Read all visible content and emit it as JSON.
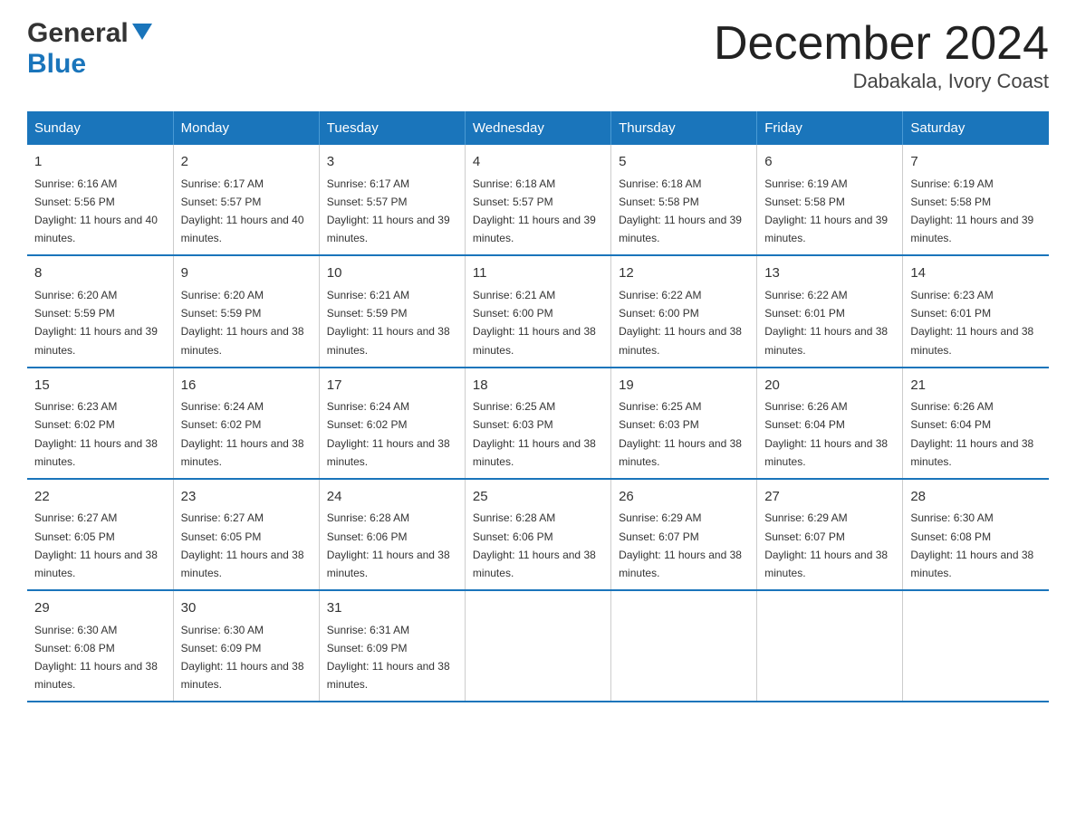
{
  "logo": {
    "text1": "General",
    "text2": "Blue"
  },
  "title": "December 2024",
  "subtitle": "Dabakala, Ivory Coast",
  "days_of_week": [
    "Sunday",
    "Monday",
    "Tuesday",
    "Wednesday",
    "Thursday",
    "Friday",
    "Saturday"
  ],
  "weeks": [
    [
      {
        "day": "1",
        "sunrise": "Sunrise: 6:16 AM",
        "sunset": "Sunset: 5:56 PM",
        "daylight": "Daylight: 11 hours and 40 minutes."
      },
      {
        "day": "2",
        "sunrise": "Sunrise: 6:17 AM",
        "sunset": "Sunset: 5:57 PM",
        "daylight": "Daylight: 11 hours and 40 minutes."
      },
      {
        "day": "3",
        "sunrise": "Sunrise: 6:17 AM",
        "sunset": "Sunset: 5:57 PM",
        "daylight": "Daylight: 11 hours and 39 minutes."
      },
      {
        "day": "4",
        "sunrise": "Sunrise: 6:18 AM",
        "sunset": "Sunset: 5:57 PM",
        "daylight": "Daylight: 11 hours and 39 minutes."
      },
      {
        "day": "5",
        "sunrise": "Sunrise: 6:18 AM",
        "sunset": "Sunset: 5:58 PM",
        "daylight": "Daylight: 11 hours and 39 minutes."
      },
      {
        "day": "6",
        "sunrise": "Sunrise: 6:19 AM",
        "sunset": "Sunset: 5:58 PM",
        "daylight": "Daylight: 11 hours and 39 minutes."
      },
      {
        "day": "7",
        "sunrise": "Sunrise: 6:19 AM",
        "sunset": "Sunset: 5:58 PM",
        "daylight": "Daylight: 11 hours and 39 minutes."
      }
    ],
    [
      {
        "day": "8",
        "sunrise": "Sunrise: 6:20 AM",
        "sunset": "Sunset: 5:59 PM",
        "daylight": "Daylight: 11 hours and 39 minutes."
      },
      {
        "day": "9",
        "sunrise": "Sunrise: 6:20 AM",
        "sunset": "Sunset: 5:59 PM",
        "daylight": "Daylight: 11 hours and 38 minutes."
      },
      {
        "day": "10",
        "sunrise": "Sunrise: 6:21 AM",
        "sunset": "Sunset: 5:59 PM",
        "daylight": "Daylight: 11 hours and 38 minutes."
      },
      {
        "day": "11",
        "sunrise": "Sunrise: 6:21 AM",
        "sunset": "Sunset: 6:00 PM",
        "daylight": "Daylight: 11 hours and 38 minutes."
      },
      {
        "day": "12",
        "sunrise": "Sunrise: 6:22 AM",
        "sunset": "Sunset: 6:00 PM",
        "daylight": "Daylight: 11 hours and 38 minutes."
      },
      {
        "day": "13",
        "sunrise": "Sunrise: 6:22 AM",
        "sunset": "Sunset: 6:01 PM",
        "daylight": "Daylight: 11 hours and 38 minutes."
      },
      {
        "day": "14",
        "sunrise": "Sunrise: 6:23 AM",
        "sunset": "Sunset: 6:01 PM",
        "daylight": "Daylight: 11 hours and 38 minutes."
      }
    ],
    [
      {
        "day": "15",
        "sunrise": "Sunrise: 6:23 AM",
        "sunset": "Sunset: 6:02 PM",
        "daylight": "Daylight: 11 hours and 38 minutes."
      },
      {
        "day": "16",
        "sunrise": "Sunrise: 6:24 AM",
        "sunset": "Sunset: 6:02 PM",
        "daylight": "Daylight: 11 hours and 38 minutes."
      },
      {
        "day": "17",
        "sunrise": "Sunrise: 6:24 AM",
        "sunset": "Sunset: 6:02 PM",
        "daylight": "Daylight: 11 hours and 38 minutes."
      },
      {
        "day": "18",
        "sunrise": "Sunrise: 6:25 AM",
        "sunset": "Sunset: 6:03 PM",
        "daylight": "Daylight: 11 hours and 38 minutes."
      },
      {
        "day": "19",
        "sunrise": "Sunrise: 6:25 AM",
        "sunset": "Sunset: 6:03 PM",
        "daylight": "Daylight: 11 hours and 38 minutes."
      },
      {
        "day": "20",
        "sunrise": "Sunrise: 6:26 AM",
        "sunset": "Sunset: 6:04 PM",
        "daylight": "Daylight: 11 hours and 38 minutes."
      },
      {
        "day": "21",
        "sunrise": "Sunrise: 6:26 AM",
        "sunset": "Sunset: 6:04 PM",
        "daylight": "Daylight: 11 hours and 38 minutes."
      }
    ],
    [
      {
        "day": "22",
        "sunrise": "Sunrise: 6:27 AM",
        "sunset": "Sunset: 6:05 PM",
        "daylight": "Daylight: 11 hours and 38 minutes."
      },
      {
        "day": "23",
        "sunrise": "Sunrise: 6:27 AM",
        "sunset": "Sunset: 6:05 PM",
        "daylight": "Daylight: 11 hours and 38 minutes."
      },
      {
        "day": "24",
        "sunrise": "Sunrise: 6:28 AM",
        "sunset": "Sunset: 6:06 PM",
        "daylight": "Daylight: 11 hours and 38 minutes."
      },
      {
        "day": "25",
        "sunrise": "Sunrise: 6:28 AM",
        "sunset": "Sunset: 6:06 PM",
        "daylight": "Daylight: 11 hours and 38 minutes."
      },
      {
        "day": "26",
        "sunrise": "Sunrise: 6:29 AM",
        "sunset": "Sunset: 6:07 PM",
        "daylight": "Daylight: 11 hours and 38 minutes."
      },
      {
        "day": "27",
        "sunrise": "Sunrise: 6:29 AM",
        "sunset": "Sunset: 6:07 PM",
        "daylight": "Daylight: 11 hours and 38 minutes."
      },
      {
        "day": "28",
        "sunrise": "Sunrise: 6:30 AM",
        "sunset": "Sunset: 6:08 PM",
        "daylight": "Daylight: 11 hours and 38 minutes."
      }
    ],
    [
      {
        "day": "29",
        "sunrise": "Sunrise: 6:30 AM",
        "sunset": "Sunset: 6:08 PM",
        "daylight": "Daylight: 11 hours and 38 minutes."
      },
      {
        "day": "30",
        "sunrise": "Sunrise: 6:30 AM",
        "sunset": "Sunset: 6:09 PM",
        "daylight": "Daylight: 11 hours and 38 minutes."
      },
      {
        "day": "31",
        "sunrise": "Sunrise: 6:31 AM",
        "sunset": "Sunset: 6:09 PM",
        "daylight": "Daylight: 11 hours and 38 minutes."
      },
      {
        "day": "",
        "sunrise": "",
        "sunset": "",
        "daylight": ""
      },
      {
        "day": "",
        "sunrise": "",
        "sunset": "",
        "daylight": ""
      },
      {
        "day": "",
        "sunrise": "",
        "sunset": "",
        "daylight": ""
      },
      {
        "day": "",
        "sunrise": "",
        "sunset": "",
        "daylight": ""
      }
    ]
  ]
}
